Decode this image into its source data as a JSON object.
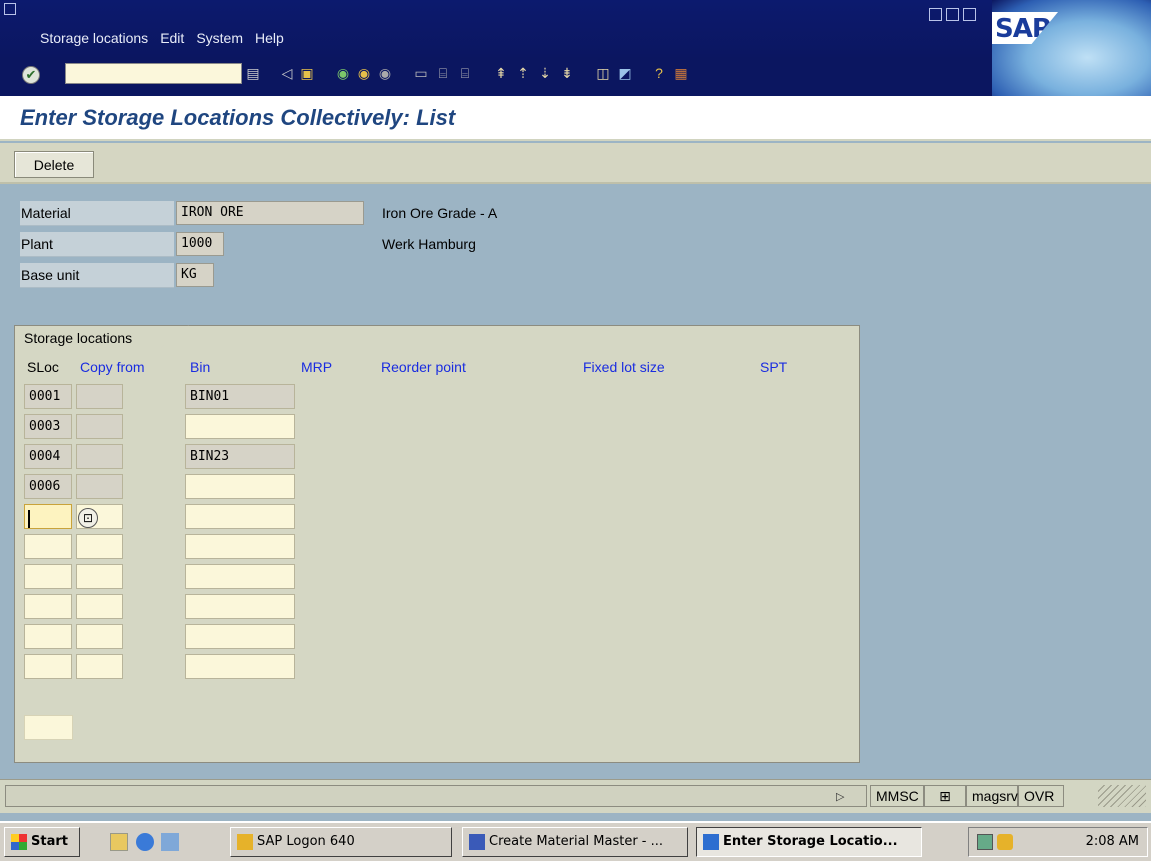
{
  "menu": [
    "Storage locations",
    "Edit",
    "System",
    "Help"
  ],
  "logo": "SAP",
  "command_field": {
    "value": ""
  },
  "title": "Enter Storage Locations Collectively: List",
  "app_toolbar": {
    "delete_label": "Delete"
  },
  "header": {
    "material": {
      "label": "Material",
      "value": "IRON ORE",
      "desc": "Iron Ore Grade - A"
    },
    "plant": {
      "label": "Plant",
      "value": "1000",
      "desc": "Werk Hamburg"
    },
    "base_unit": {
      "label": "Base unit",
      "value": "KG"
    }
  },
  "group_title": "Storage locations",
  "columns": [
    "SLoc",
    "Copy from",
    "Bin",
    "MRP",
    "Reorder point",
    "Fixed lot size",
    "SPT"
  ],
  "rows": [
    {
      "sloc": "0001",
      "bin": "BIN01"
    },
    {
      "sloc": "0003",
      "bin": ""
    },
    {
      "sloc": "0004",
      "bin": "BIN23"
    },
    {
      "sloc": "0006",
      "bin": ""
    }
  ],
  "status": {
    "transaction": "MMSC",
    "server": "magsrv",
    "mode": "OVR"
  },
  "taskbar": {
    "start": "Start",
    "items": [
      "SAP Logon 640",
      "Create Material Master - ...",
      "Enter Storage Locatio..."
    ],
    "clock": "2:08 AM"
  },
  "colors": {
    "title_bar": "#0b1660",
    "page_title": "#1f4680",
    "column_header": "#1a2ce0",
    "background": "#9cb4c4"
  }
}
